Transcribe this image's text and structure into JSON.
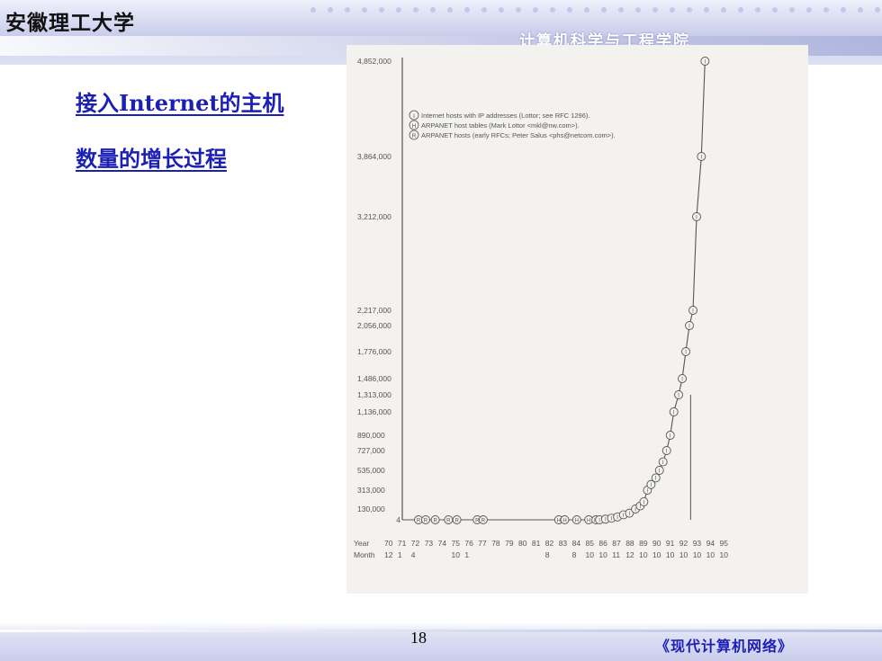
{
  "header": {
    "university": "安徽理工大学",
    "department": "计算机科学与工程学院"
  },
  "slide": {
    "title_line1": "接入Internet的主机",
    "title_line2": "数量的增长过程"
  },
  "footer": {
    "page_number": "18",
    "book_title": "《现代计算机网络》"
  },
  "colors": {
    "title": "#1c1fb5",
    "chart_background": "#f3f2ef",
    "chart_ink": "#555555"
  },
  "chart_data": {
    "type": "line",
    "title": "",
    "xlabel": "Year",
    "x2label": "Month",
    "ylabel": "",
    "y_ticks": [
      {
        "value": 4852000,
        "label": "4,852,000"
      },
      {
        "value": 3864000,
        "label": "3,864,000"
      },
      {
        "value": 3212000,
        "label": "3,212,000"
      },
      {
        "value": 2217000,
        "label": "2,217,000"
      },
      {
        "value": 2056000,
        "label": "2,056,000"
      },
      {
        "value": 1776000,
        "label": "1,776,000"
      },
      {
        "value": 1486000,
        "label": "1,486,000"
      },
      {
        "value": 1313000,
        "label": "1,313,000"
      },
      {
        "value": 1136000,
        "label": "1,136,000"
      },
      {
        "value": 890000,
        "label": "890,000"
      },
      {
        "value": 727000,
        "label": "727,000"
      },
      {
        "value": 535000,
        "label": "535,000"
      },
      {
        "value": 313000,
        "label": "313,000"
      },
      {
        "value": 130000,
        "label": "130,000"
      },
      {
        "value": 4,
        "label": "4"
      }
    ],
    "year_labels": [
      "70",
      "71",
      "72",
      "73",
      "74",
      "75",
      "76",
      "77",
      "78",
      "79",
      "80",
      "81",
      "82",
      "83",
      "84",
      "85",
      "86",
      "87",
      "88",
      "89",
      "90",
      "91",
      "92",
      "93",
      "94",
      "95"
    ],
    "month_labels": [
      {
        "year": 70,
        "label": "12"
      },
      {
        "year": 71,
        "label": "1"
      },
      {
        "year": 72,
        "label": "4"
      },
      {
        "year": 75,
        "label": "10"
      },
      {
        "year": 76,
        "label": "1"
      },
      {
        "year": 82,
        "label": "8"
      },
      {
        "year": 84,
        "label": "8"
      },
      {
        "year": 85,
        "label": "10"
      },
      {
        "year": 86,
        "label": "10"
      },
      {
        "year": 87,
        "label": "11"
      },
      {
        "year": 88,
        "label": "12"
      },
      {
        "year": 89,
        "label": "10"
      },
      {
        "year": 90,
        "label": "10"
      },
      {
        "year": 91,
        "label": "10"
      },
      {
        "year": 92,
        "label": "10"
      },
      {
        "year": 93,
        "label": "10"
      },
      {
        "year": 94,
        "label": "10"
      },
      {
        "year": 95,
        "label": "10"
      }
    ],
    "legend": [
      {
        "marker": "I",
        "text": "Internet hosts with IP addresses (Lottor; see RFC 1296)."
      },
      {
        "marker": "H",
        "text": "ARPANET host tables (Mark Lottor <mkl@nw.com>)."
      },
      {
        "marker": "R",
        "text": "ARPANET hosts (early RFCs; Peter Salus <phs@netcom.com>)."
      }
    ],
    "legend_position": "top",
    "grid": false,
    "series": [
      {
        "name": "ARPANET hosts (early RFCs; Peter Salus <phs@netcom.com>).",
        "marker": "R",
        "x": [
          70.9,
          71.5,
          72.3,
          73.4,
          74.1,
          75.8,
          76.3
        ],
        "y": [
          4,
          4,
          4,
          4,
          4,
          4,
          4
        ]
      },
      {
        "name": "ARPANET host tables (Mark Lottor <mkl@nw.com>).",
        "marker": "H",
        "x": [
          82.6,
          83.1,
          84.1,
          85.1,
          85.7
        ],
        "y": [
          4,
          4,
          4,
          4,
          4
        ]
      },
      {
        "name": "Internet hosts with IP addresses (Lottor; see RFC 1296).",
        "marker": "I",
        "x": [
          86.0,
          86.5,
          87.0,
          87.5,
          88.0,
          88.5,
          89.0,
          89.4,
          89.7,
          90.0,
          90.3,
          90.7,
          91.0,
          91.3,
          91.6,
          91.9,
          92.2,
          92.6,
          92.9,
          93.2,
          93.5,
          93.8,
          94.1,
          94.5,
          94.8
        ],
        "y": [
          4,
          8000,
          20000,
          35000,
          60000,
          80000,
          130000,
          160000,
          200000,
          313000,
          376000,
          450000,
          535000,
          617000,
          727000,
          890000,
          1136000,
          1313000,
          1486000,
          1776000,
          2056000,
          2217000,
          3212000,
          3864000,
          4852000
        ]
      }
    ],
    "vertical_marker_x": 93.6
  }
}
